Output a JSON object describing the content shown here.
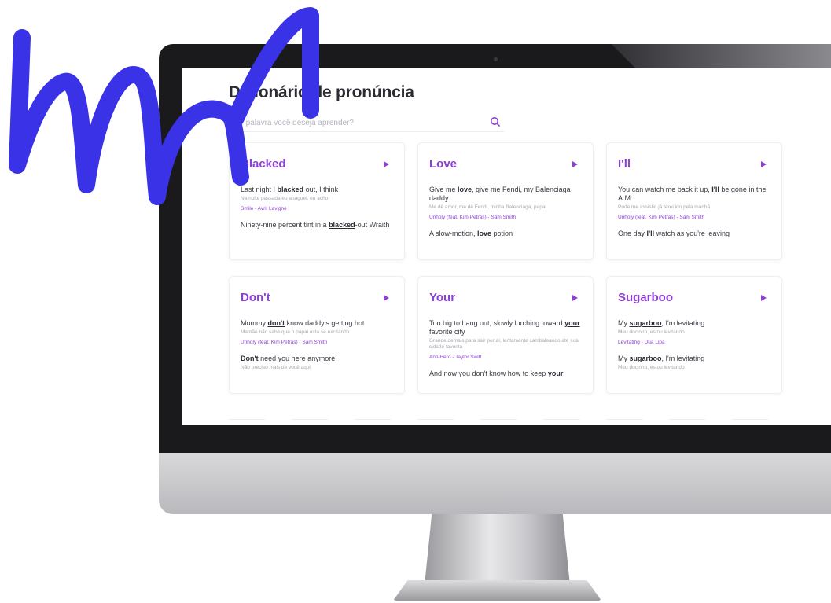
{
  "colors": {
    "accent": "#8e3fd6",
    "scribble": "#3a32e6"
  },
  "page": {
    "title": "Dicionário de pronúncia",
    "search": {
      "placeholder": "Que palavra você deseja aprender?",
      "value": ""
    }
  },
  "cards": [
    {
      "word": "Blacked",
      "examples": [
        {
          "pre": "Last night I ",
          "kw": "blacked",
          "post": " out, I think",
          "translation": "Na noite passada eu apaguei, eu acho",
          "source": "Smile - Avril Lavigne"
        },
        {
          "pre": "Ninety-nine percent tint in a ",
          "kw": "blacked",
          "post": "-out Wraith",
          "translation": "",
          "source": ""
        }
      ]
    },
    {
      "word": "Love",
      "examples": [
        {
          "pre": "Give me ",
          "kw": "love",
          "post": ", give me Fendi, my Balenciaga daddy",
          "translation": "Me dê amor, me dê Fendi, minha Balenciaga, papai",
          "source": "Unholy (feat. Kim Petras) - Sam Smith"
        },
        {
          "pre": "A slow-motion, ",
          "kw": "love",
          "post": " potion",
          "translation": "",
          "source": ""
        }
      ]
    },
    {
      "word": "I'll",
      "examples": [
        {
          "pre": "You can watch me back it up, ",
          "kw": "I'll",
          "post": " be gone in the A.M.",
          "translation": "Pode me assistir, já terei ido pela manhã",
          "source": "Unholy (feat. Kim Petras) - Sam Smith"
        },
        {
          "pre": "One day ",
          "kw": "I'll",
          "post": " watch as you're leaving",
          "translation": "",
          "source": ""
        }
      ]
    },
    {
      "word": "Don't",
      "examples": [
        {
          "pre": "Mummy ",
          "kw": "don't",
          "post": " know daddy's getting hot",
          "translation": "Mamãe não sabe que o papai está se excitando",
          "source": "Unholy (feat. Kim Petras) - Sam Smith"
        },
        {
          "pre": "",
          "kw": "Don't",
          "post": " need you here anymore",
          "translation": "Não preciso mais de você aqui",
          "source": ""
        }
      ]
    },
    {
      "word": "Your",
      "examples": [
        {
          "pre": "Too big to hang out, slowly lurching toward ",
          "kw": "your",
          "post": " favorite city",
          "translation": "Grande demais para sair por aí, lentamente cambaleando até sua cidade favorita",
          "source": "Anti-Hero - Taylor Swift"
        },
        {
          "pre": "And now you don't know how to keep ",
          "kw": "your",
          "post": "",
          "translation": "",
          "source": ""
        }
      ]
    },
    {
      "word": "Sugarboo",
      "examples": [
        {
          "pre": "My ",
          "kw": "sugarboo",
          "post": ", I'm levitating",
          "translation": "Meu docinho, estou levitando",
          "source": "Levitating - Dua Lipa"
        },
        {
          "pre": "My ",
          "kw": "sugarboo",
          "post": ", I'm levitating",
          "translation": "Meu docinho, estou levitando",
          "source": ""
        }
      ]
    }
  ]
}
